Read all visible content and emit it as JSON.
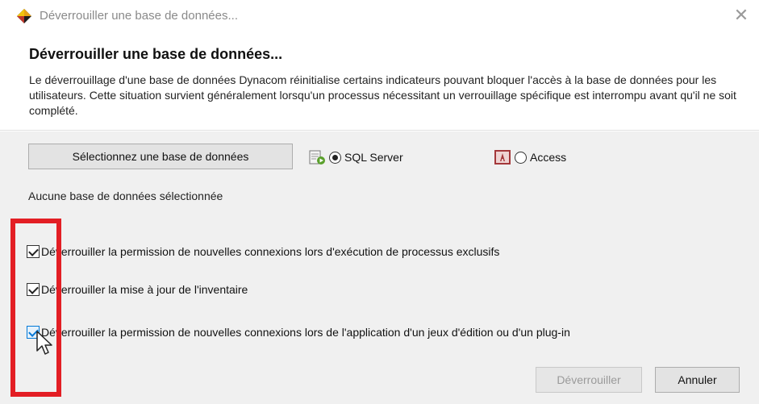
{
  "window": {
    "title": "Déverrouiller une base de données...",
    "close_glyph": "✕"
  },
  "header": {
    "heading": "Déverrouiller une base de données...",
    "description": "Le déverrouillage d'une base de données Dynacom réinitialise certains indicateurs pouvant bloquer l'accès à la base de données pour les utilisateurs. Cette situation survient généralement lorsqu'un processus nécessitant un verrouillage spécifique est interrompu avant qu'il ne soit complété."
  },
  "database": {
    "select_button_label": "Sélectionnez une base de données",
    "options": [
      {
        "label": "SQL Server",
        "icon": "sql-server-icon",
        "selected": true
      },
      {
        "label": "Access",
        "icon": "access-icon",
        "selected": false
      }
    ],
    "status": "Aucune base de données sélectionnée"
  },
  "options": [
    {
      "label": "Déverrouiller la permission de nouvelles connexions lors d'exécution de processus exclusifs",
      "checked": true
    },
    {
      "label": "Déverrouiller la mise à jour de l'inventaire",
      "checked": true
    },
    {
      "label": "Déverrouiller la permission de nouvelles connexions lors de l'application d'un jeux d'édition ou d'un plug-in",
      "checked": true,
      "hovered": true
    }
  ],
  "actions": {
    "unlock_label": "Déverrouiller",
    "unlock_enabled": false,
    "cancel_label": "Annuler"
  },
  "colors": {
    "highlight": "#e31e24",
    "body_background": "#f0f0f0",
    "accent": "#0078d7"
  }
}
